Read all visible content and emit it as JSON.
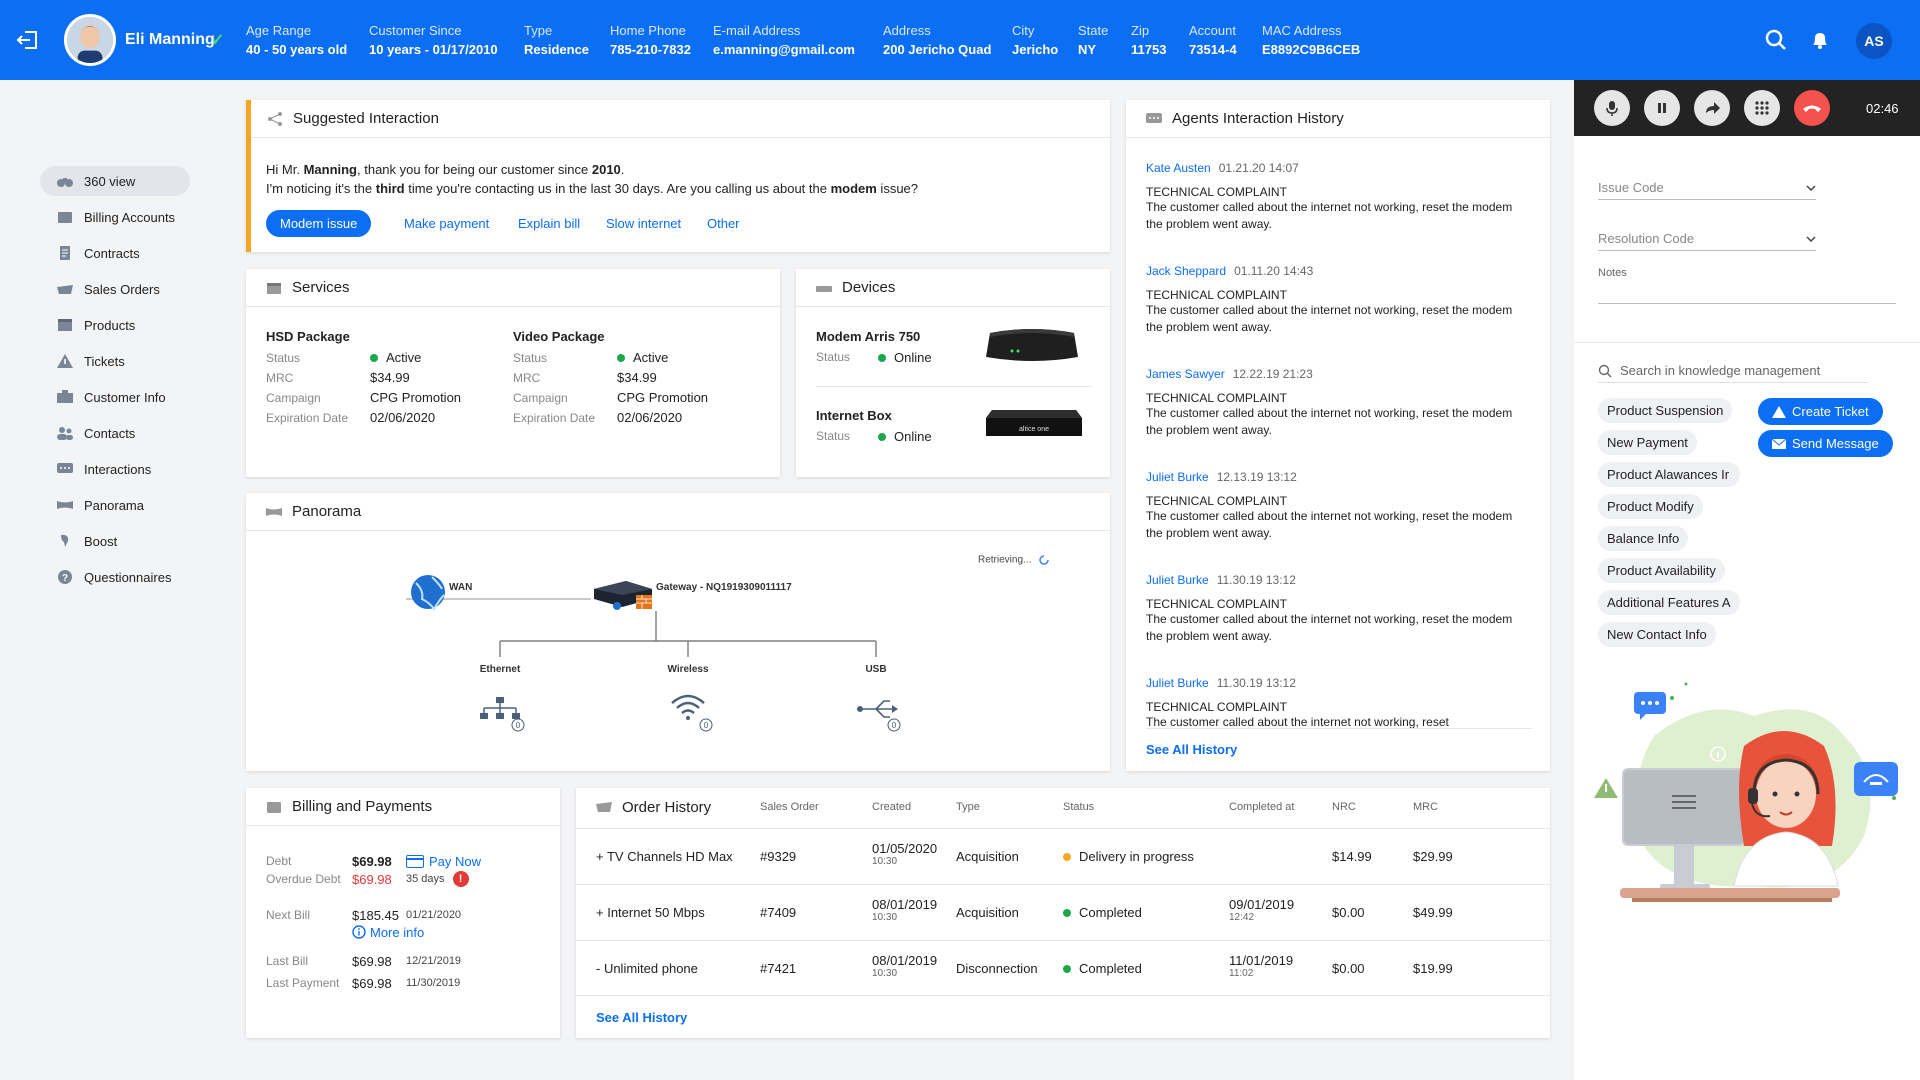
{
  "header": {
    "customer_name": "Eli Manning",
    "fields": [
      {
        "label": "Age Range",
        "value": "40 - 50 years old"
      },
      {
        "label": "Customer Since",
        "value": "10 years - 01/17/2010"
      },
      {
        "label": "Type",
        "value": "Residence"
      },
      {
        "label": "Home Phone",
        "value": "785-210-7832"
      },
      {
        "label": "E-mail Address",
        "value": "e.manning@gmail.com"
      },
      {
        "label": "Address",
        "value": "200 Jericho Quad"
      },
      {
        "label": "City",
        "value": "Jericho"
      },
      {
        "label": "State",
        "value": "NY"
      },
      {
        "label": "Zip",
        "value": "11753"
      },
      {
        "label": "Account",
        "value": "73514-4"
      },
      {
        "label": "MAC Address",
        "value": "E8892C9B6CEB"
      }
    ],
    "user_initials": "AS",
    "icons": [
      "exit-icon",
      "search-icon",
      "notification-icon"
    ]
  },
  "sidebar": {
    "items": [
      {
        "label": "360 view",
        "icon": "binoculars-icon"
      },
      {
        "label": "Billing Accounts",
        "icon": "wallet-icon"
      },
      {
        "label": "Contracts",
        "icon": "document-icon"
      },
      {
        "label": "Sales Orders",
        "icon": "cart-icon"
      },
      {
        "label": "Products",
        "icon": "box-icon"
      },
      {
        "label": "Tickets",
        "icon": "warning-icon"
      },
      {
        "label": "Customer Info",
        "icon": "id-card-icon"
      },
      {
        "label": "Contacts",
        "icon": "contacts-icon"
      },
      {
        "label": "Interactions",
        "icon": "chat-icon"
      },
      {
        "label": "Panorama",
        "icon": "panorama-icon"
      },
      {
        "label": "Boost",
        "icon": "boost-icon"
      },
      {
        "label": "Questionnaires",
        "icon": "question-icon"
      }
    ]
  },
  "suggested": {
    "title": "Suggested Interaction",
    "line1_a": "Hi Mr. ",
    "line1_b": "Manning",
    "line1_c": ", thank you for being our customer since ",
    "line1_d": "2010",
    "line1_e": ".",
    "line2_a": "I'm noticing it's the ",
    "line2_b": "third",
    "line2_c": " time you're contacting us in the last 30 days. Are you calling us about the ",
    "line2_d": "modem",
    "line2_e": " issue?",
    "primary_action": "Modem issue",
    "actions": [
      "Make payment",
      "Explain bill",
      "Slow internet",
      "Other"
    ]
  },
  "services": {
    "title": "Services",
    "packages": [
      {
        "name": "HSD Package",
        "status_label": "Status",
        "status": "Active",
        "mrc_label": "MRC",
        "mrc": "$34.99",
        "campaign_label": "Campaign",
        "campaign": "CPG Promotion",
        "exp_label": "Expiration Date",
        "exp": "02/06/2020"
      },
      {
        "name": "Video Package",
        "status_label": "Status",
        "status": "Active",
        "mrc_label": "MRC",
        "mrc": "$34.99",
        "campaign_label": "Campaign",
        "campaign": "CPG Promotion",
        "exp_label": "Expiration Date",
        "exp": "02/06/2020"
      }
    ]
  },
  "devices": {
    "title": "Devices",
    "items": [
      {
        "name": "Modem Arris 750",
        "status_label": "Status",
        "status": "Online"
      },
      {
        "name": "Internet Box",
        "status_label": "Status",
        "status": "Online",
        "brand": "altice one"
      }
    ]
  },
  "panorama": {
    "title": "Panorama",
    "retrieving": "Retrieving...",
    "wan": "WAN",
    "gateway": "Gateway - NQ1919309011117",
    "ports": [
      {
        "label": "Ethernet",
        "count": "0"
      },
      {
        "label": "Wireless",
        "count": "0"
      },
      {
        "label": "USB",
        "count": "0"
      }
    ]
  },
  "billing": {
    "title": "Billing and Payments",
    "debt_label": "Debt",
    "debt": "$69.98",
    "pay_now": "Pay Now",
    "overdue_label": "Overdue Debt",
    "overdue": "$69.98",
    "overdue_days": "35 days",
    "next_bill_label": "Next Bill",
    "next_bill": "$185.45",
    "next_bill_date": "01/21/2020",
    "more_info": "More info",
    "last_bill_label": "Last Bill",
    "last_bill": "$69.98",
    "last_bill_date": "12/21/2019",
    "last_payment_label": "Last Payment",
    "last_payment": "$69.98",
    "last_payment_date": "11/30/2019"
  },
  "orders": {
    "title": "Order History",
    "headers": [
      "Sales Order",
      "Created",
      "Type",
      "Status",
      "Completed at",
      "NRC",
      "MRC"
    ],
    "rows": [
      {
        "item": "+ TV Channels HD Max",
        "so": "#9329",
        "created": "01/05/2020",
        "created_time": "10:30",
        "type": "Acquisition",
        "status": "Delivery in progress",
        "status_color": "orange",
        "completed": "",
        "completed_time": "",
        "nrc": "$14.99",
        "mrc": "$29.99"
      },
      {
        "item": "+ Internet 50 Mbps",
        "so": "#7409",
        "created": "08/01/2019",
        "created_time": "10:30",
        "type": "Acquisition",
        "status": "Completed",
        "status_color": "green",
        "completed": "09/01/2019",
        "completed_time": "12:42",
        "nrc": "$0.00",
        "mrc": "$49.99"
      },
      {
        "item": "- Unlimited phone",
        "so": "#7421",
        "created": "08/01/2019",
        "created_time": "10:30",
        "type": "Disconnection",
        "status": "Completed",
        "status_color": "green",
        "completed": "11/01/2019",
        "completed_time": "11:02",
        "nrc": "$0.00",
        "mrc": "$19.99"
      }
    ],
    "see_all": "See All History"
  },
  "history": {
    "title": "Agents Interaction History",
    "entries": [
      {
        "agent": "Kate Austen",
        "time": "01.21.20  14:07",
        "type": "TECHNICAL COMPLAINT",
        "text": "The customer called about the internet not working, reset the modem the problem went away."
      },
      {
        "agent": "Jack Sheppard",
        "time": "01.11.20  14:43",
        "type": "TECHNICAL COMPLAINT",
        "text": "The customer called about the internet not working, reset the modem the problem went away."
      },
      {
        "agent": "James Sawyer",
        "time": "12.22.19  21:23",
        "type": "TECHNICAL COMPLAINT",
        "text": "The customer called about the internet not working, reset the modem the problem went away."
      },
      {
        "agent": "Juliet Burke",
        "time": "12.13.19  13:12",
        "type": "TECHNICAL COMPLAINT",
        "text": "The customer called about the internet not working, reset the modem the problem went away."
      },
      {
        "agent": "Juliet Burke",
        "time": "11.30.19  13:12",
        "type": "TECHNICAL COMPLAINT",
        "text": "The customer called about the internet not working, reset the modem the problem went away."
      },
      {
        "agent": "Juliet Burke",
        "time": "11.30.19  13:12",
        "type": "TECHNICAL COMPLAINT",
        "text": "The customer called about the internet not working, reset"
      }
    ],
    "see_all": "See All History"
  },
  "call": {
    "timer": "02:46",
    "buttons": [
      "microphone-icon",
      "pause-icon",
      "forward-icon",
      "keypad-icon",
      "hangup-icon"
    ]
  },
  "right": {
    "issue_code": "Issue Code",
    "resolution_code": "Resolution Code",
    "notes": "Notes",
    "search_placeholder": "Search in knowledge management",
    "tags": [
      "Product Suspension",
      "New Payment",
      "Product Alawances Ir",
      "Product Modify",
      "Balance Info",
      "Product Availability",
      "Additional Features A",
      "New Contact Info"
    ],
    "create_ticket": "Create Ticket",
    "send_message": "Send Message"
  },
  "colors": {
    "primary": "#0b6ef3",
    "danger": "#e53935",
    "success": "#1aa84a",
    "warning": "#f5a623"
  }
}
